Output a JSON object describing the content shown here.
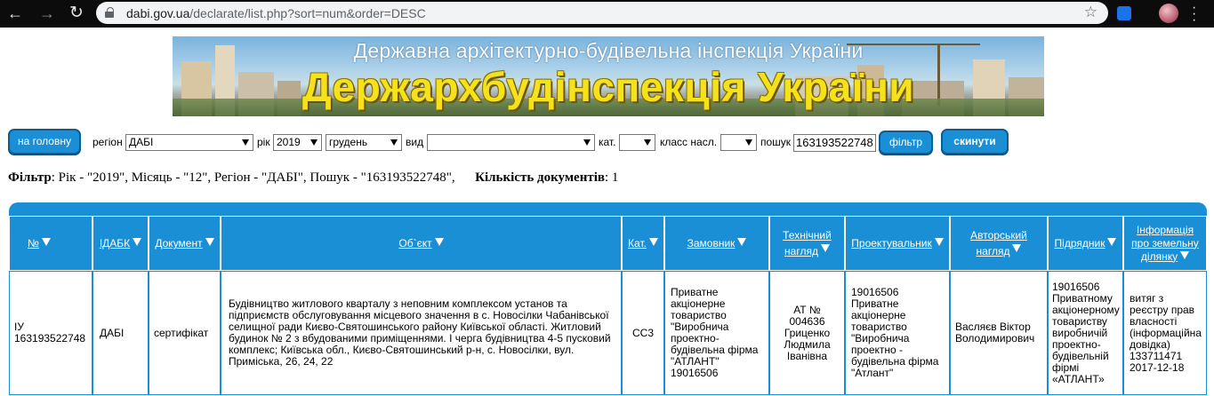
{
  "browser": {
    "url_host": "dabi.gov.ua",
    "url_path": "/declarate/list.php?sort=num&order=DESC"
  },
  "banner": {
    "subtitle": "Державна архітектурно-будівельна інспекція України",
    "title": "Держархбудінспекція України"
  },
  "toolbar": {
    "home_label": "на головну",
    "region_label": "регіон",
    "region_value": "ДАБІ",
    "year_label": "рік",
    "year_value": "2019",
    "month_value": "грудень",
    "type_label": "вид",
    "type_value": "",
    "category_label": "кат.",
    "category_value": "",
    "class_label": "класс насл.",
    "class_value": "",
    "search_label": "пошук",
    "search_value": "163193522748",
    "filter_label": "фільтр",
    "reset_label": "скинути"
  },
  "summary": {
    "filter_label": "Фільтр",
    "filter_text": ": Рік - \"2019\", Місяць - \"12\", Регіон - \"ДАБІ\", Пошук - \"163193522748\",",
    "count_label": "Кількість документів",
    "count_text": ": 1"
  },
  "table": {
    "headers": {
      "num": "№",
      "idabk": "ІДАБК",
      "document": "Документ",
      "object": "Об`єкт",
      "category": "Кат.",
      "customer": "Замовник",
      "tech_supervision": "Технічний нагляд",
      "designer": "Проектувальник",
      "author_supervision": "Авторський нагляд",
      "contractor": "Підрядник",
      "land_info": "Інформація про земельну ділянку"
    },
    "row": {
      "num": "ІУ 163193522748",
      "idabk": "ДАБІ",
      "document": "сертифікат",
      "object": "Будівництво житлового кварталу з неповним комплексом установ та підприємств обслуговування місцевого значення в с. Новосілки Чабанівської селищної ради Києво-Святошинського району Київської області. Житловий будинок № 2 з вбудованими приміщеннями. І черга будівництва 4-5 пусковий комплекс; Київська обл., Києво-Святошинський р-н, с. Новосілки, вул. Приміська, 26, 24, 22",
      "category": "СС3",
      "customer": "Приватне акціонерне товариство \"Виробнича проектно-будівельна фірма \"АТЛАНТ\" 19016506",
      "tech_supervision": "АТ № 004636 Гриценко Людмила Іванівна",
      "designer": "19016506 Приватне акціонерне товариство \"Виробнича проектно - будівельна фірма \"Атлант\"",
      "author_supervision": "Васляєв Віктор Володимирович",
      "contractor": "19016506 Приватному акціонерному товариству виробничій проектно-будівельній фірмі «АТЛАНТ»",
      "land_info": "витяг з реєстру прав власності (інформаційна довідка) 133711471 2017-12-18"
    }
  },
  "colors": {
    "accent": "#1a8fd6",
    "banner_title": "#f6e21a"
  }
}
